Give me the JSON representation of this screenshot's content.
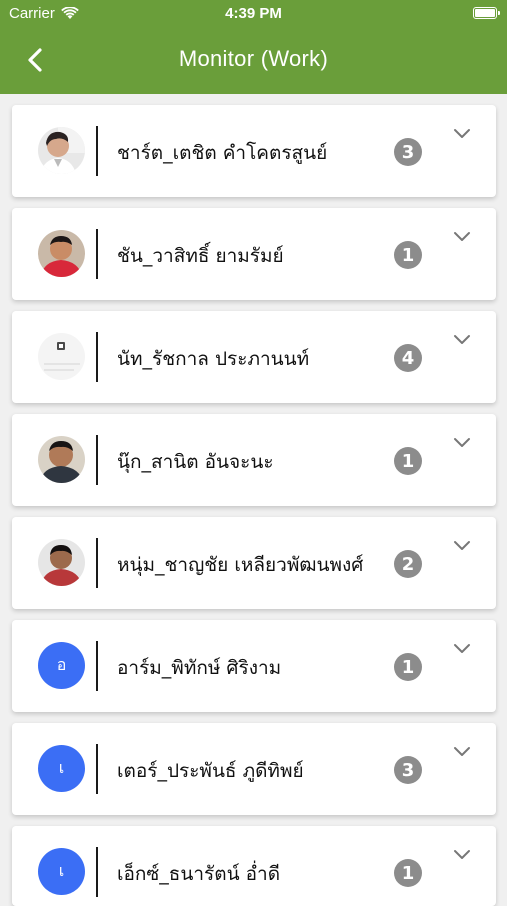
{
  "status_bar": {
    "carrier": "Carrier",
    "time": "4:39 PM"
  },
  "header": {
    "title": "Monitor (Work)",
    "color": "#6a9e3a"
  },
  "items": [
    {
      "name": "ชาร์ต_เตชิต คำโคตรสูนย์",
      "count": "3",
      "avatar_type": "photo",
      "avatar_letter": ""
    },
    {
      "name": "ชัน_วาสิทธิ์ ยามรัมย์",
      "count": "1",
      "avatar_type": "photo",
      "avatar_letter": ""
    },
    {
      "name": "นัท_รัชกาล ประภานนท์",
      "count": "4",
      "avatar_type": "photo",
      "avatar_letter": ""
    },
    {
      "name": "นุ๊ก_สานิต อันจะนะ",
      "count": "1",
      "avatar_type": "photo",
      "avatar_letter": ""
    },
    {
      "name": "หนุ่ม_ชาญชัย เหลียวพัฒนพงศ์",
      "count": "2",
      "avatar_type": "photo",
      "avatar_letter": ""
    },
    {
      "name": "อาร์ม_พิทักษ์ ศิริงาม",
      "count": "1",
      "avatar_type": "letter",
      "avatar_letter": "อ"
    },
    {
      "name": "เตอร์_ประพันธ์ ภูดีทิพย์",
      "count": "3",
      "avatar_type": "letter",
      "avatar_letter": "เ"
    },
    {
      "name": "เอ็กซ์_ธนารัตน์ อ่ำดี",
      "count": "1",
      "avatar_type": "letter",
      "avatar_letter": "เ"
    }
  ]
}
